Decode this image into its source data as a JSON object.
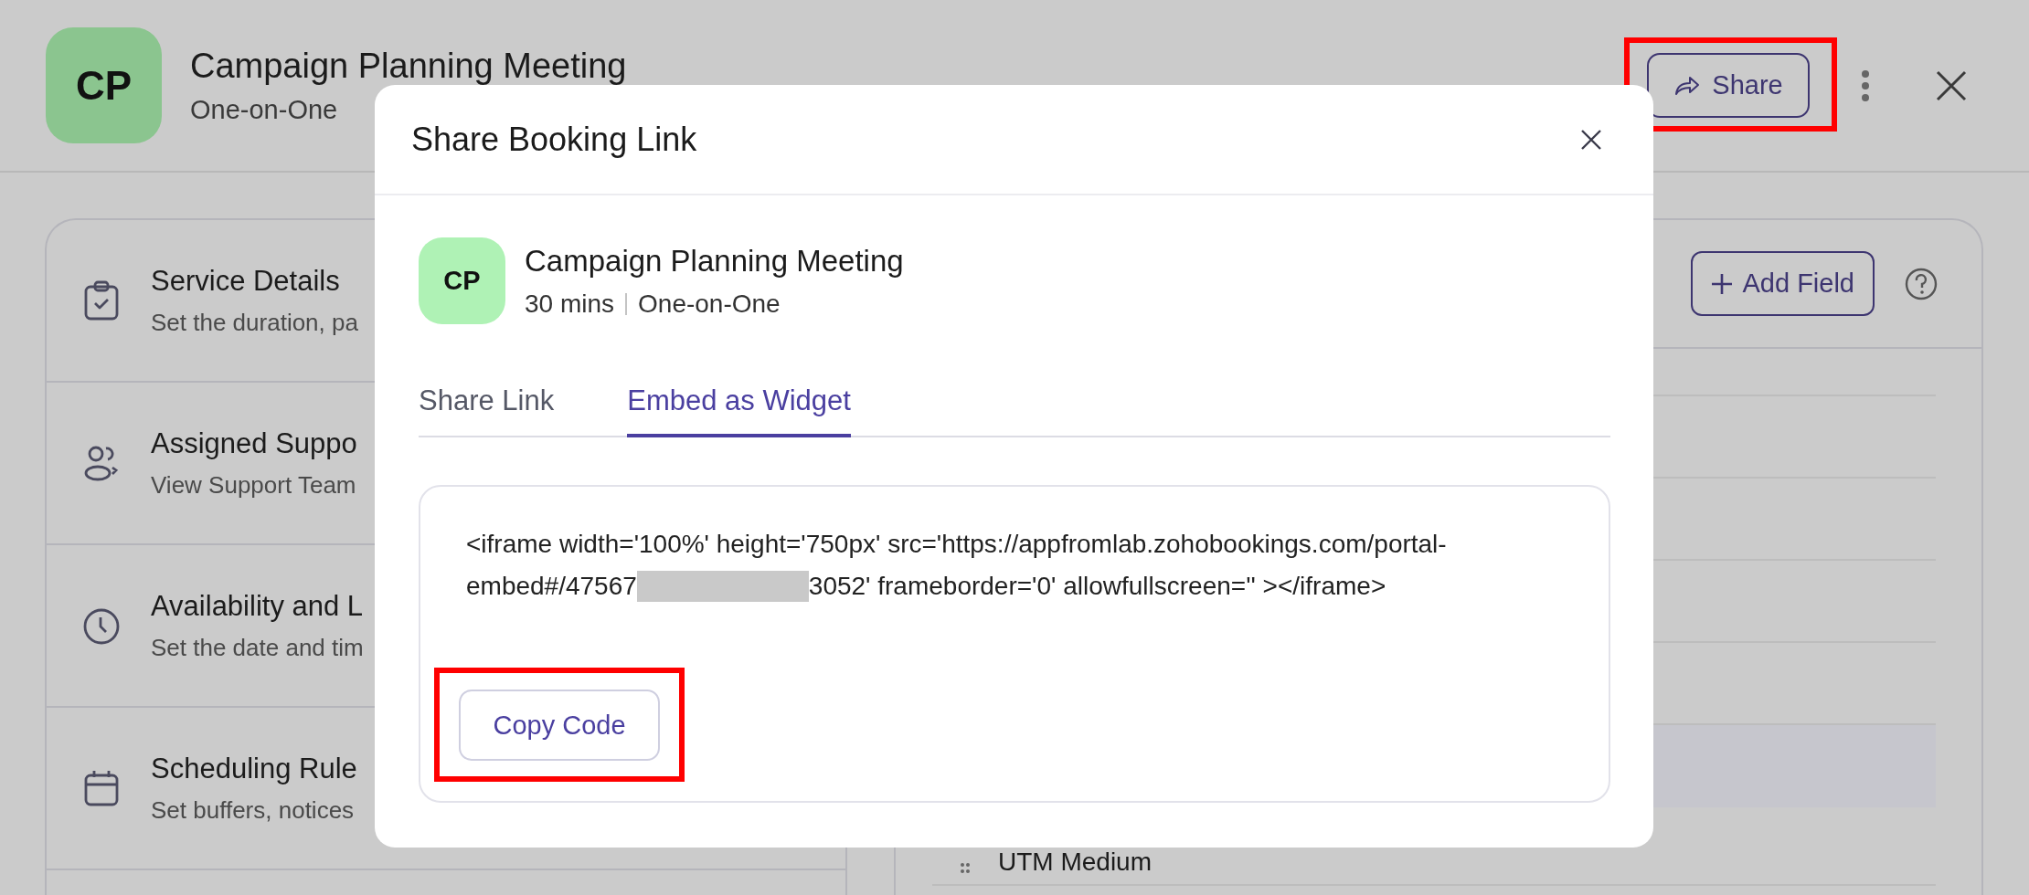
{
  "header": {
    "avatar": "CP",
    "title": "Campaign Planning Meeting",
    "subtitle": "One-on-One",
    "share_button": {
      "label": "Share",
      "highlighted": true
    }
  },
  "sections": [
    {
      "kind": "clipboard",
      "title": "Service Details",
      "description": "Set the duration, pa"
    },
    {
      "kind": "people",
      "title": "Assigned Suppo",
      "description": "View Support Team"
    },
    {
      "kind": "clock",
      "title": "Availability and L",
      "description": "Set the date and tim"
    },
    {
      "kind": "calendar",
      "title": "Scheduling Rule",
      "description": "Set buffers, notices"
    }
  ],
  "fields_panel": {
    "add_button": "Add Field",
    "rows": [
      {
        "highlighted": false
      },
      {
        "highlighted": false
      },
      {
        "highlighted": false
      },
      {
        "highlighted": false
      },
      {
        "highlighted": false
      },
      {
        "highlighted": true
      },
      {
        "label": "UTM Medium",
        "highlighted": false
      }
    ]
  },
  "dialog": {
    "title": "Share Booking Link",
    "event": {
      "avatar": "CP",
      "title": "Campaign Planning Meeting",
      "duration": "30 mins",
      "type": "One-on-One"
    },
    "tabs": [
      {
        "label": "Share Link",
        "selected": false
      },
      {
        "label": "Embed as Widget",
        "selected": true
      }
    ],
    "code": {
      "line_1": "<iframe width='100%' height='750px' src='https://appfromlab.zohobookings.com/portal-",
      "line_2_start": "embed#/47567",
      "redacted": true,
      "line_2_end": "3052' frameborder='0' allowfullscreen='' ></iframe>"
    },
    "copy_button": {
      "label": "Copy Code",
      "highlighted": true
    }
  }
}
